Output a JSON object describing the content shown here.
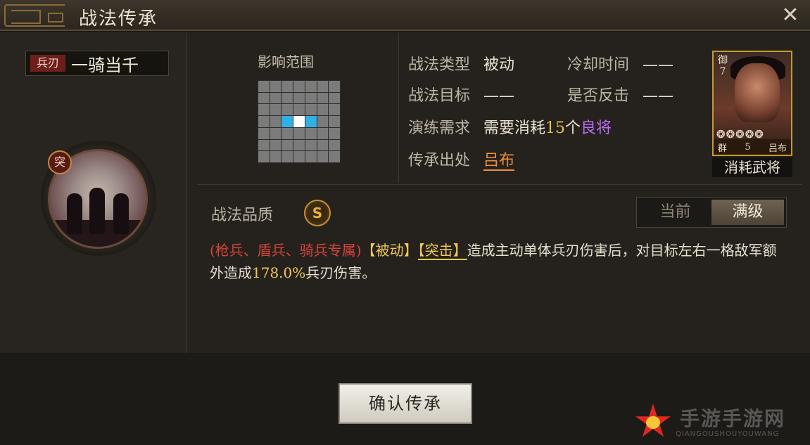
{
  "window": {
    "title": "战法传承",
    "close_icon": "close-icon"
  },
  "skill": {
    "troop_tag": "兵刃",
    "name": "一骑当千",
    "emblem_badge": "突"
  },
  "range": {
    "label": "影响范围",
    "grid_size": 7,
    "highlight": {
      "center": [
        3,
        3
      ],
      "sides": [
        [
          3,
          2
        ],
        [
          3,
          4
        ]
      ]
    }
  },
  "info": {
    "type_label": "战法类型",
    "type_value": "被动",
    "cooldown_label": "冷却时间",
    "cooldown_value": "——",
    "target_label": "战法目标",
    "target_value": "——",
    "counter_label": "是否反击",
    "counter_value": "——",
    "req_label": "演练需求",
    "req_prefix": "需要消耗",
    "req_count": "15",
    "req_unit": "个",
    "req_quality": "良将",
    "source_label": "传承出处",
    "source_value": "吕布"
  },
  "hero_card": {
    "side_text": "御7",
    "stars": "❂❂❂❂❂",
    "faction": "群",
    "cost": "5",
    "name": "吕布",
    "caption": "消耗武将"
  },
  "quality": {
    "label": "战法品质",
    "grade": "S"
  },
  "toggle": {
    "current": "当前",
    "max": "满级"
  },
  "description": {
    "troops": "(枪兵、盾兵、骑兵专属)",
    "tag_passive": "【被动】",
    "tag_assault": "【突击】",
    "text1": "造成主动单体兵刃伤害后，对目标左右一格敌军额外造成",
    "percent": "178.0%",
    "text2": "兵刃伤害。"
  },
  "confirm_button": "确认传承",
  "watermark": {
    "text": "手游手游网",
    "sub": "QIANGOUSHOUYOUWANG"
  },
  "colors": {
    "accent_gold": "#e5c04d",
    "purple": "#b96cff",
    "orange": "#f0903a",
    "red": "#d6423a"
  }
}
